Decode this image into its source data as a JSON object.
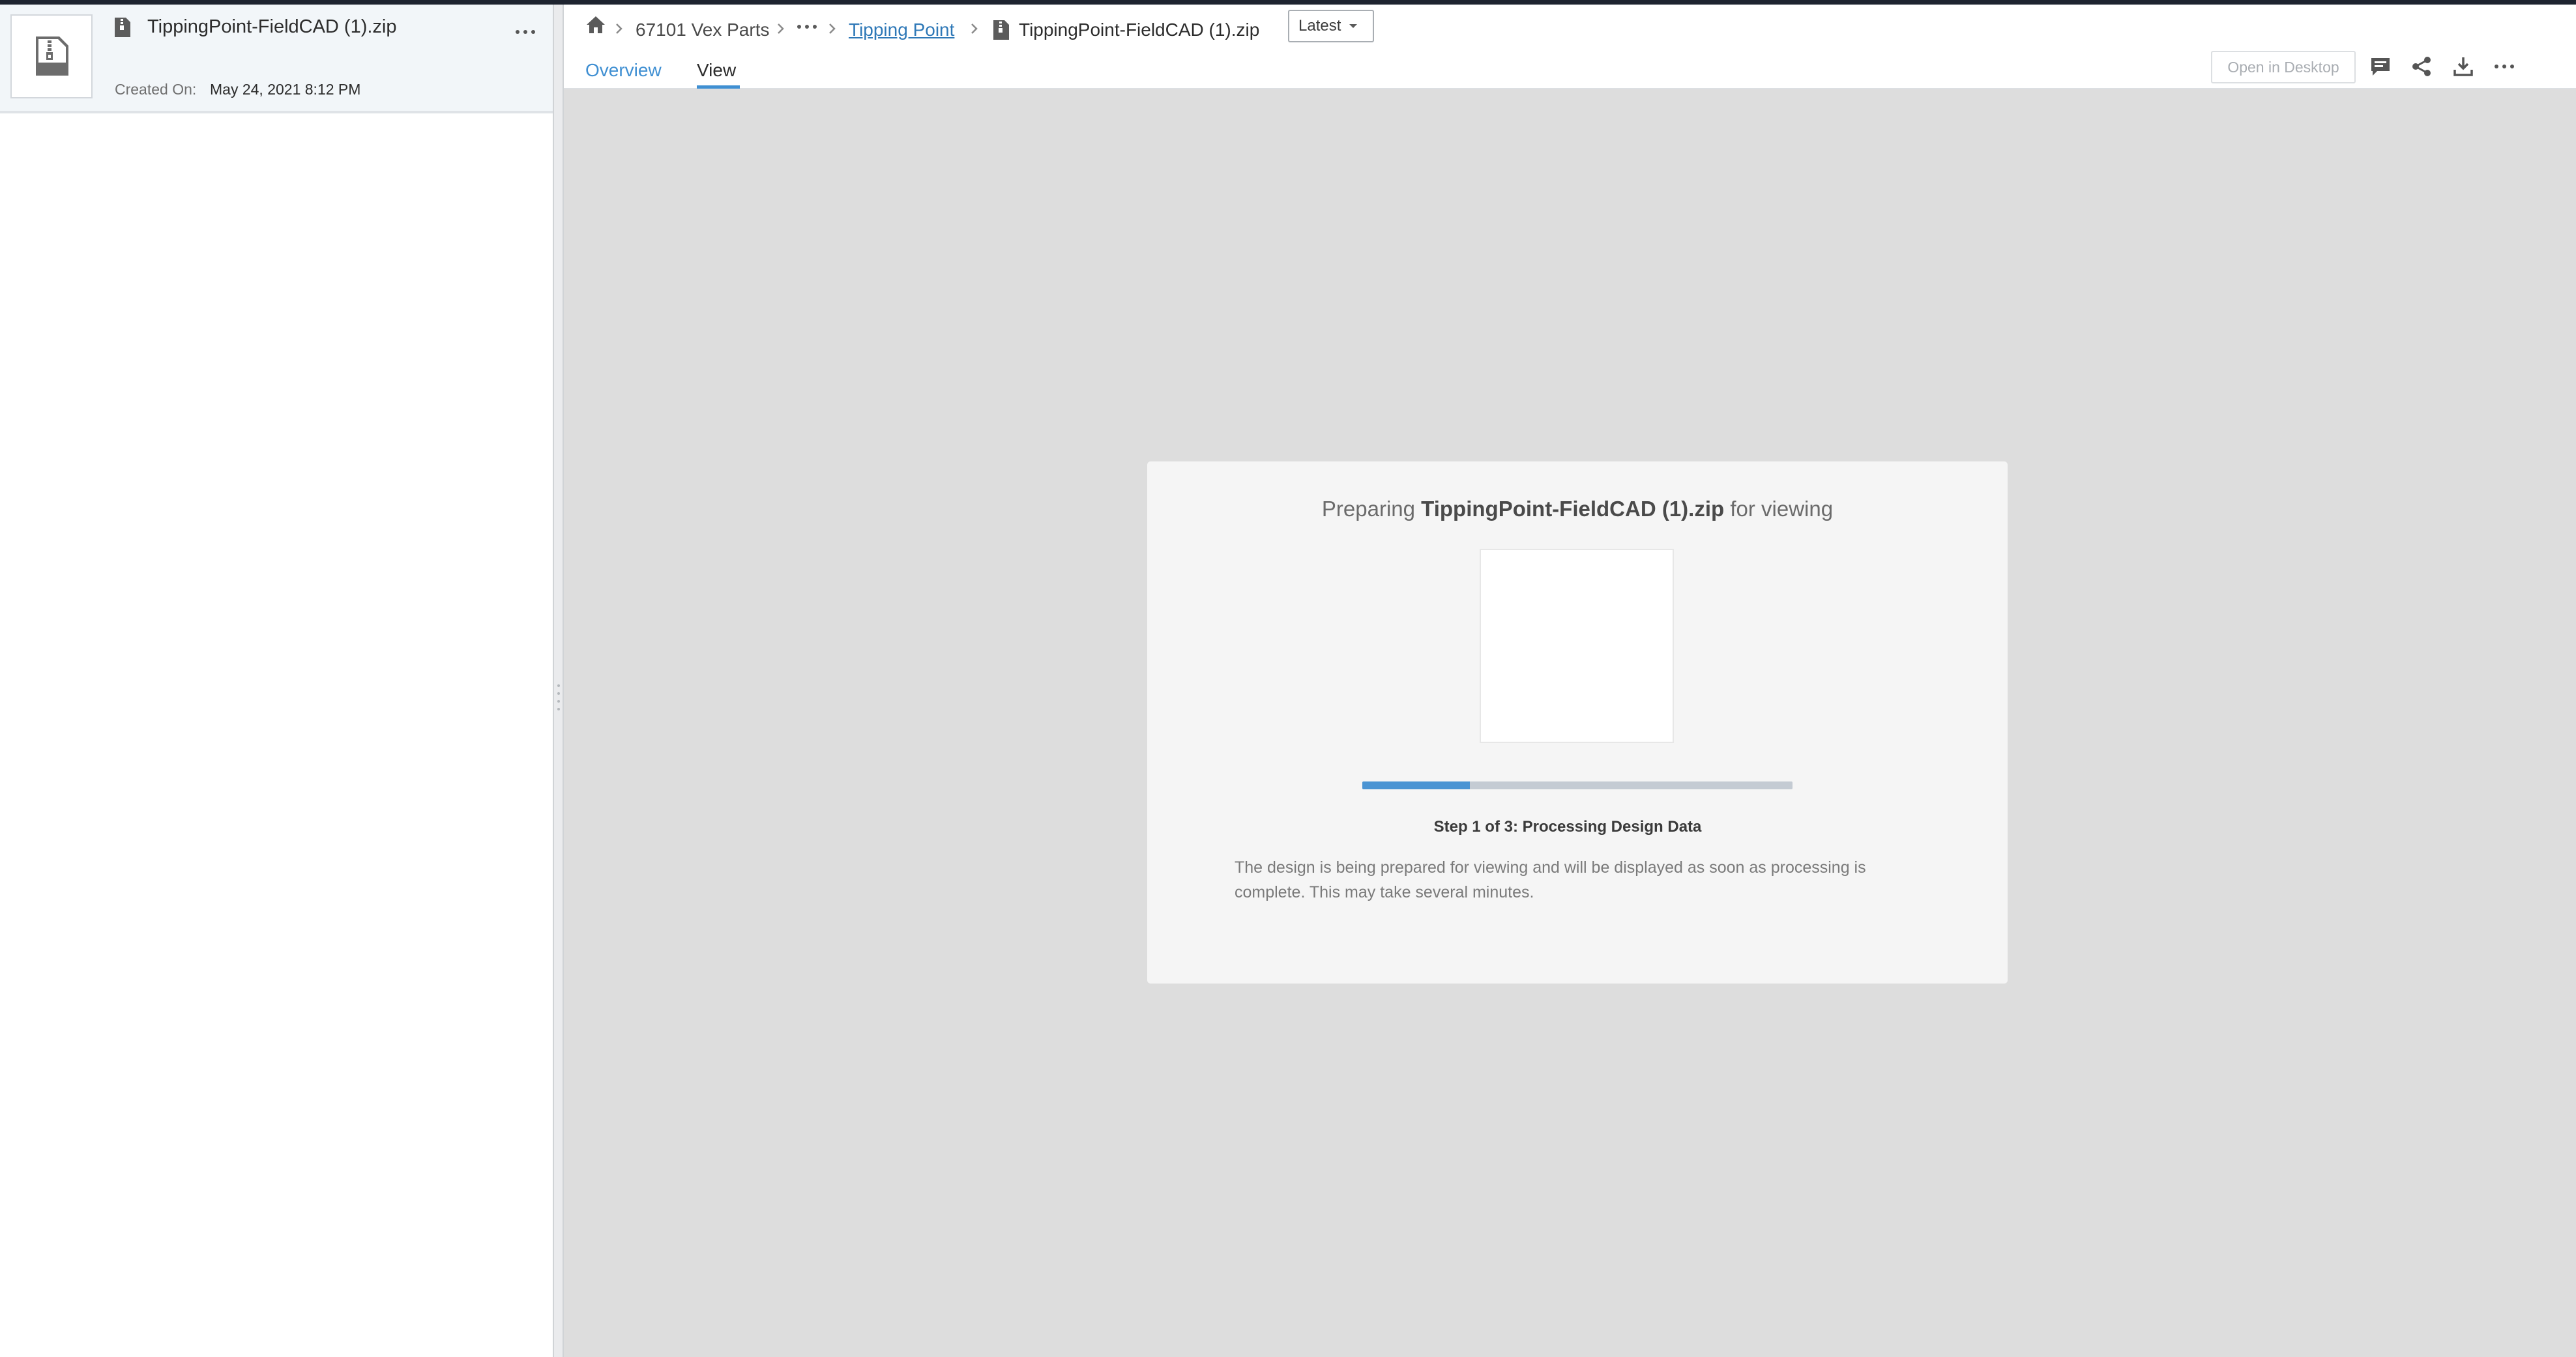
{
  "file": {
    "name": "TippingPoint-FieldCAD (1).zip",
    "created_label": "Created On:",
    "created_value": "May 24, 2021 8:12 PM"
  },
  "breadcrumb": {
    "project": "67101 Vex Parts",
    "folder": "Tipping Point",
    "current": "TippingPoint-FieldCAD (1).zip"
  },
  "version": {
    "selected": "Latest"
  },
  "tabs": {
    "overview": "Overview",
    "view": "View"
  },
  "toolbar": {
    "open_desktop": "Open in Desktop"
  },
  "viewer": {
    "title_prefix": "Preparing",
    "title_file": "TippingPoint-FieldCAD (1).zip",
    "title_suffix": "for viewing",
    "progress_fraction": 0.25,
    "step": "Step 1 of 3: Processing Design Data",
    "description": "The design is being prepared for viewing and will be displayed as soon as processing is complete. This may take several minutes."
  },
  "colors": {
    "accent": "#3f8fd2",
    "progress": "#4a94d3",
    "track": "#c4cbd3",
    "viewer_bg": "#dddddd"
  },
  "icons": [
    "zip-file-icon",
    "more-options-icon",
    "home-icon",
    "chevron-right-icon",
    "ellipsis-icon",
    "chevron-down-icon",
    "comment-icon",
    "share-icon",
    "download-icon"
  ]
}
